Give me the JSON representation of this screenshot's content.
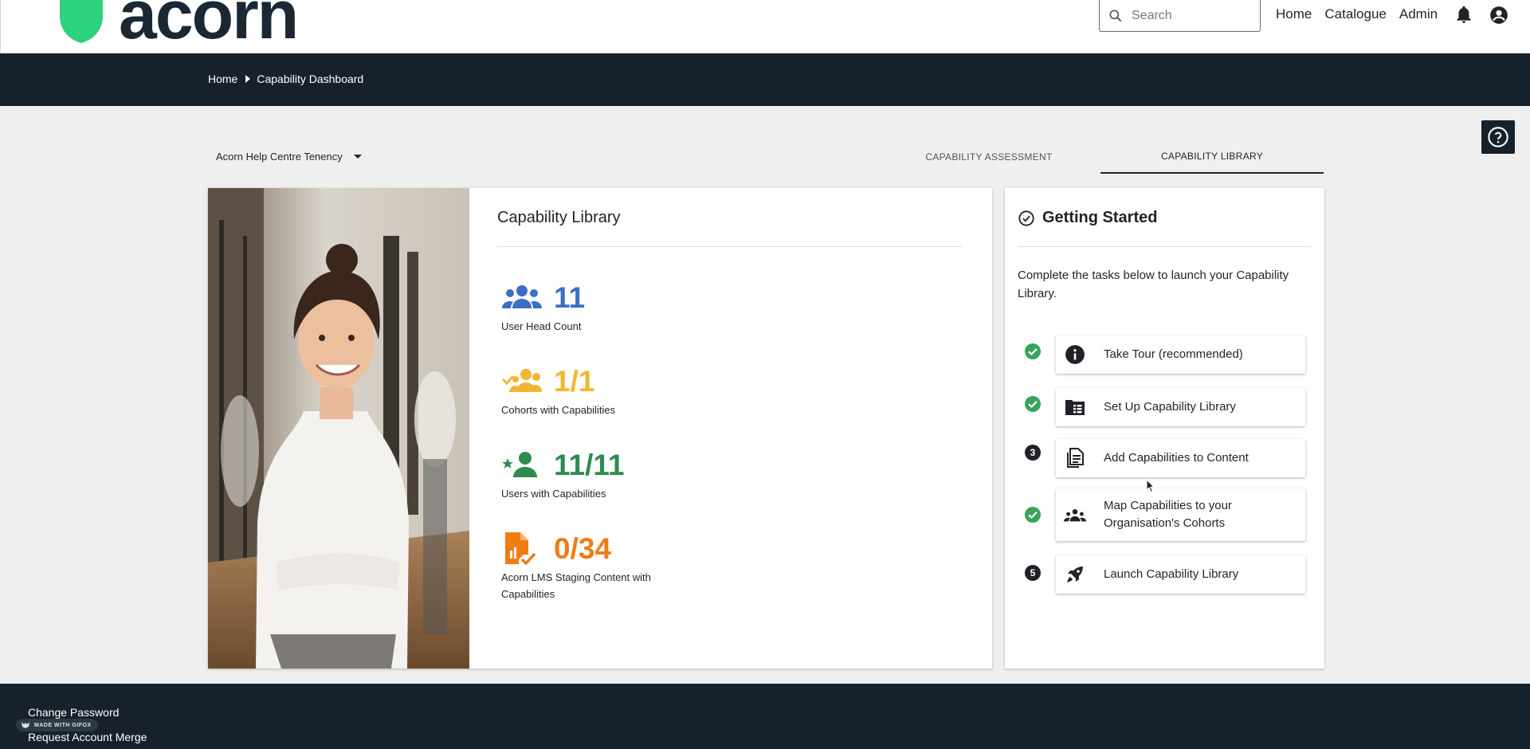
{
  "header": {
    "logo_text": "acorn",
    "search_placeholder": "Search",
    "nav": [
      "Home",
      "Catalogue",
      "Admin"
    ]
  },
  "breadcrumb": [
    "Home",
    "Capability Dashboard"
  ],
  "tenancy": "Acorn Help Centre Tenency",
  "tabs": [
    "CAPABILITY ASSESSMENT",
    "CAPABILITY LIBRARY"
  ],
  "main": {
    "title": "Capability Library",
    "stats": [
      {
        "value": "11",
        "label": "User Head Count",
        "color": "#3a6fc7",
        "icon": "group-icon"
      },
      {
        "value": "1/1",
        "label": "Cohorts with Capabilities",
        "color": "#f2b630",
        "icon": "group-check-icon"
      },
      {
        "value": "11/11",
        "label": "Users with Capabilities",
        "color": "#2e8b4f",
        "icon": "person-star-icon"
      },
      {
        "value": "0/34",
        "label": "Acorn LMS Staging Content with Capabilities",
        "color": "#ef7d14",
        "icon": "document-check-icon"
      }
    ]
  },
  "getting_started": {
    "title": "Getting Started",
    "description": "Complete the tasks below to launch your Capability Library.",
    "tasks": [
      {
        "label": "Take Tour (recommended)",
        "status": "done",
        "icon": "info-icon"
      },
      {
        "label": "Set Up Capability Library",
        "status": "done",
        "icon": "folder-list-icon"
      },
      {
        "label": "Add Capabilities to Content",
        "status": "3",
        "icon": "document-icon"
      },
      {
        "label": "Map Capabilities to your Organisation's Cohorts",
        "status": "done",
        "icon": "people-icon"
      },
      {
        "label": "Launch Capability Library",
        "status": "5",
        "icon": "rocket-icon"
      }
    ]
  },
  "footer": {
    "links": [
      "Change Password",
      "Request Account Merge"
    ],
    "badge": "MADE WITH GIFOX"
  },
  "colors": {
    "dark": "#16212b",
    "brand_green": "#2ed17c",
    "done_green": "#3aa35b"
  }
}
